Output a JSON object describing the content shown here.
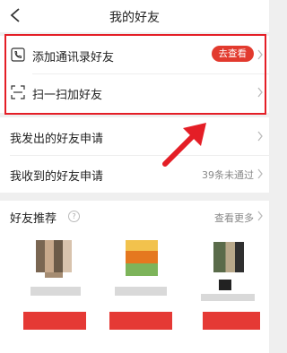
{
  "header": {
    "title": "我的好友"
  },
  "highlight_card": {
    "rows": [
      {
        "label": "添加通讯录好友",
        "badge": "去查看",
        "icon": "phone-contact-icon"
      },
      {
        "label": "扫一扫加好友",
        "icon": "scan-icon"
      }
    ]
  },
  "requests": {
    "sent_label": "我发出的好友申请",
    "received_label": "我收到的好友申请",
    "received_status": "39条未通过"
  },
  "recommend": {
    "title": "好友推荐",
    "help_icon": "?",
    "more_label": "查看更多"
  },
  "colors": {
    "accent": "#e41e26",
    "badge": "#e23a2e",
    "background": "#efefef"
  }
}
